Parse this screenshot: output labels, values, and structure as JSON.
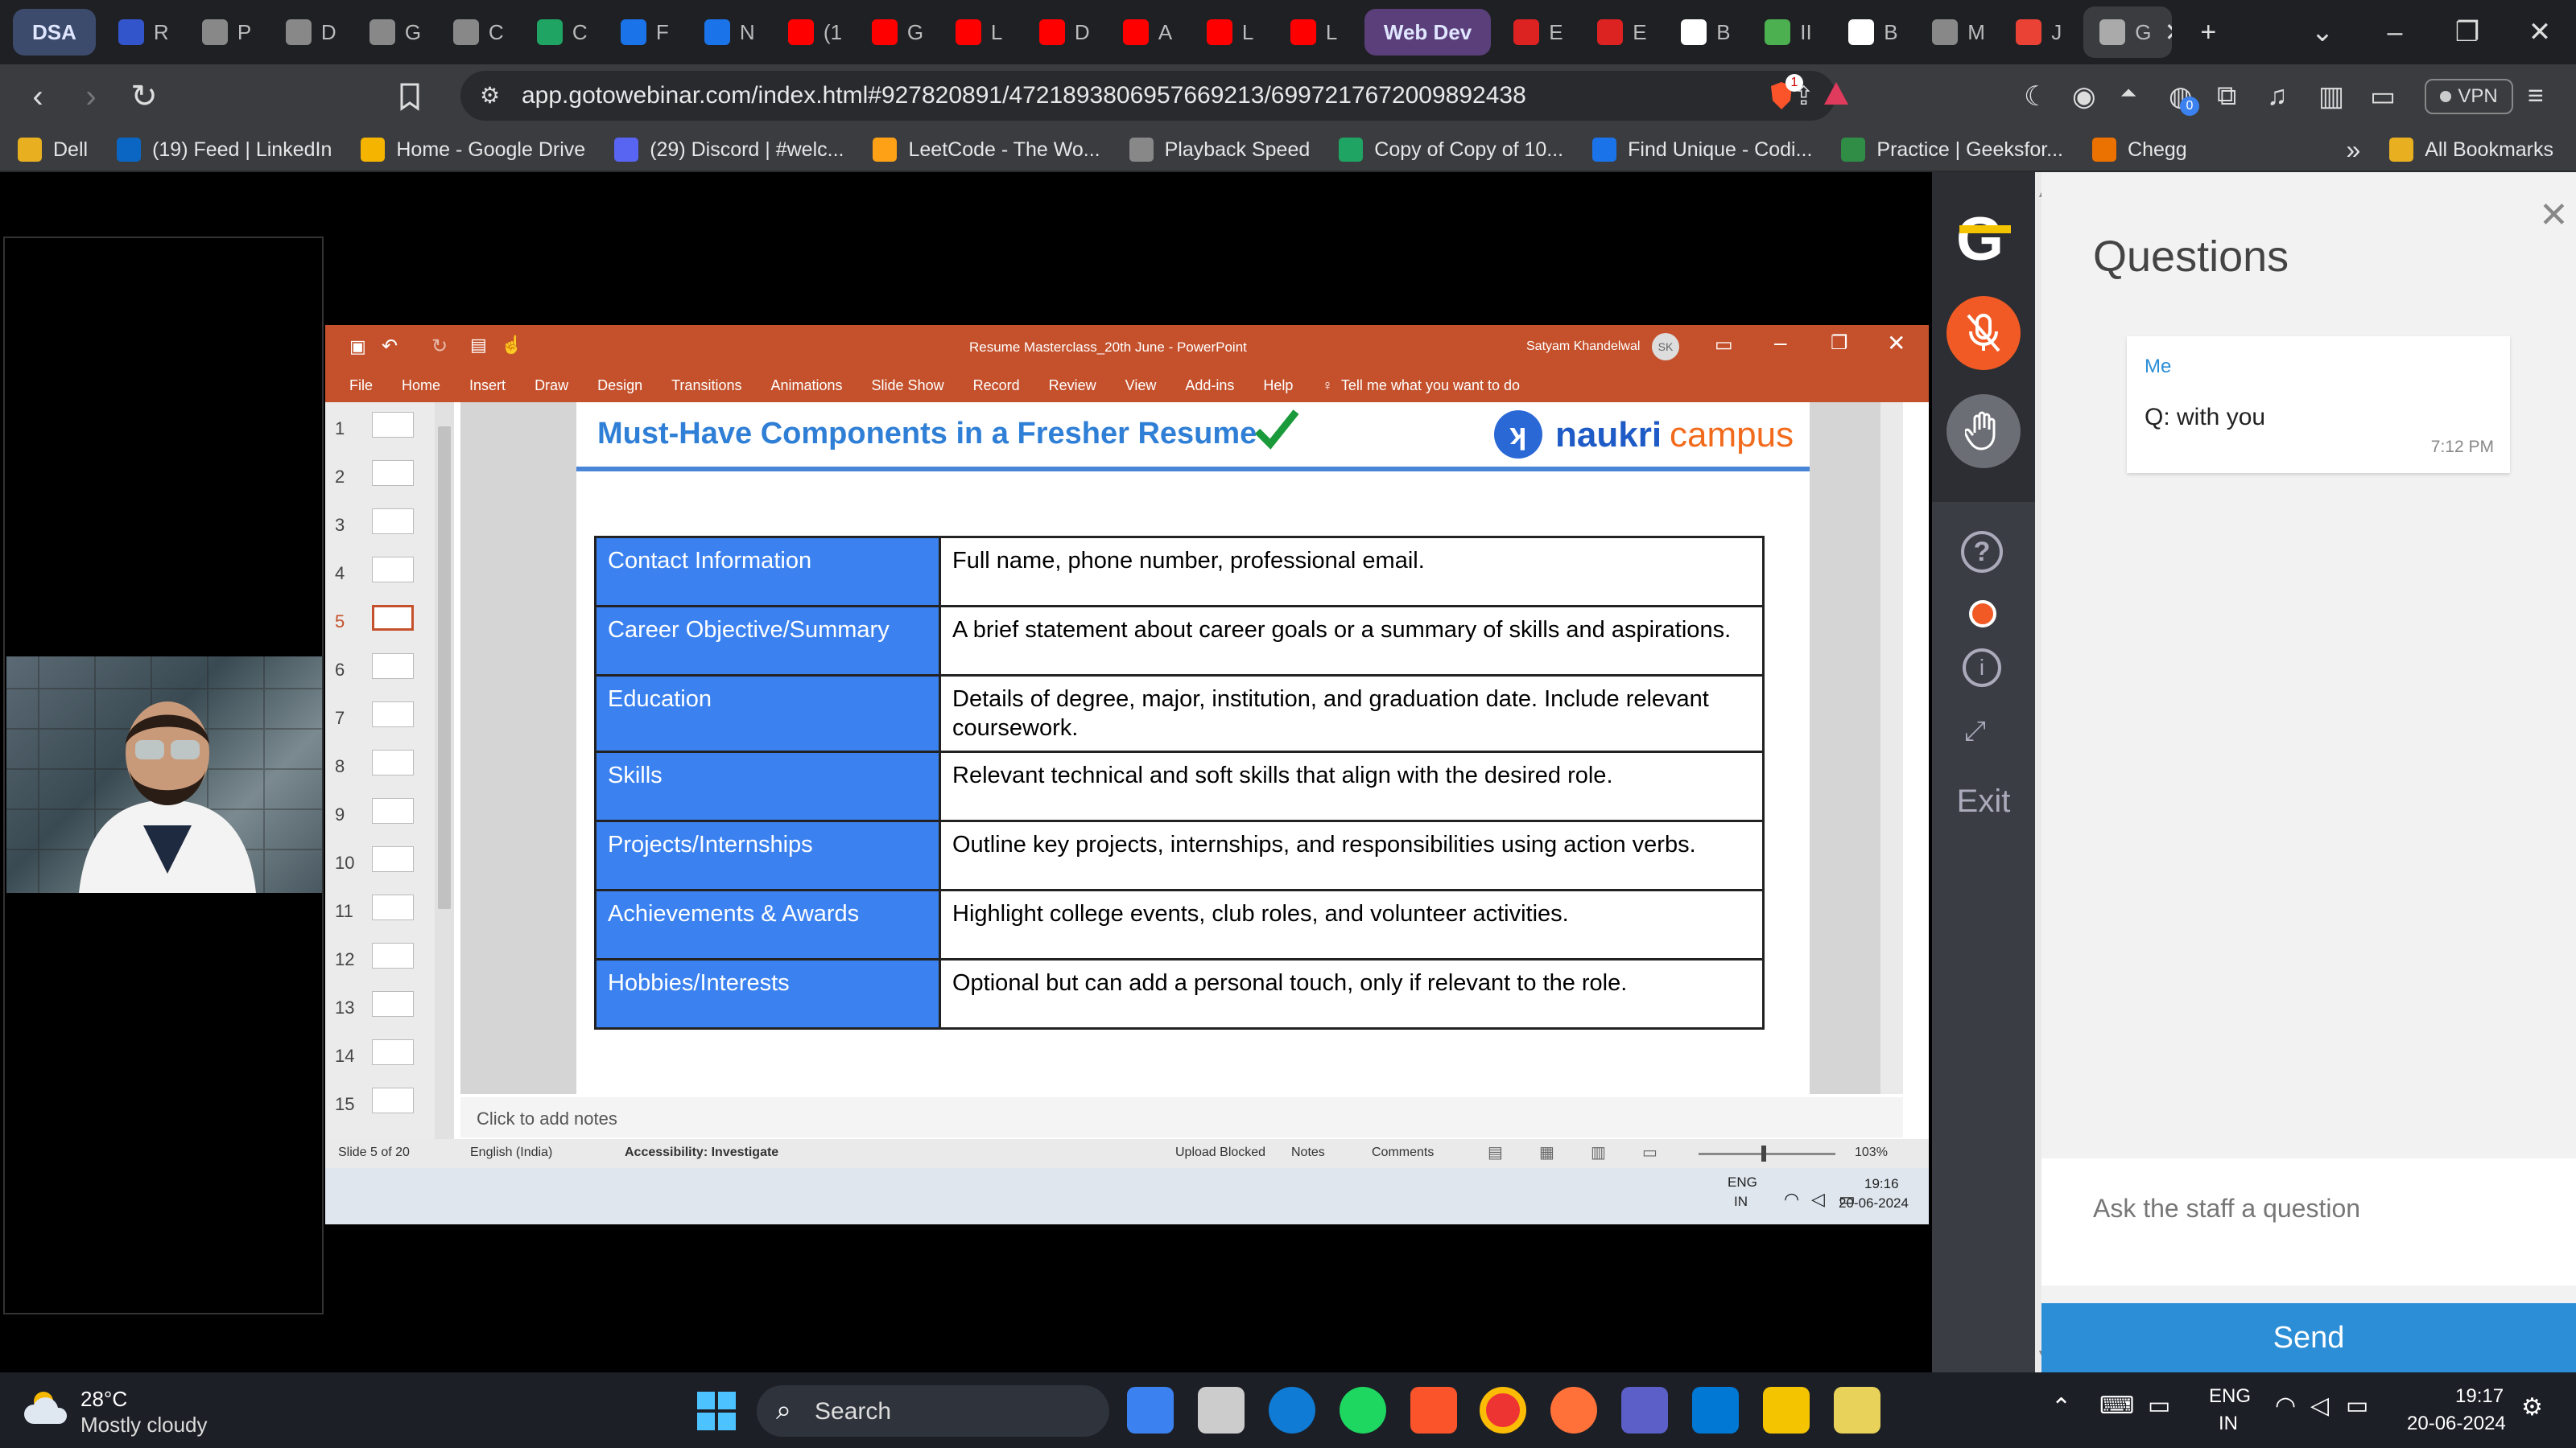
{
  "browser": {
    "tabs": [
      {
        "label": "DSA",
        "kind": "group",
        "color": "#3c4b6b"
      },
      {
        "label": "R",
        "icon": "r-icon",
        "color": "#3355cc"
      },
      {
        "label": "P",
        "icon": "mountain-icon",
        "color": "#888"
      },
      {
        "label": "D",
        "icon": "mountain-icon",
        "color": "#888"
      },
      {
        "label": "G",
        "icon": "mountain-icon",
        "color": "#888"
      },
      {
        "label": "C",
        "icon": "globe-icon",
        "color": "#888"
      },
      {
        "label": "C",
        "icon": "plus-green-icon",
        "color": "#1fa463"
      },
      {
        "label": "F",
        "icon": "codingninja-icon",
        "color": "#1a73e8"
      },
      {
        "label": "N",
        "icon": "codingninja-icon",
        "color": "#1a73e8"
      },
      {
        "label": "(1",
        "icon": "youtube-icon",
        "color": "#ff0000"
      },
      {
        "label": "G",
        "icon": "youtube-icon",
        "color": "#ff0000"
      },
      {
        "label": "L",
        "icon": "youtube-icon",
        "color": "#ff0000"
      },
      {
        "label": "D",
        "icon": "youtube-icon",
        "color": "#ff0000"
      },
      {
        "label": "A",
        "icon": "youtube-icon",
        "color": "#ff0000"
      },
      {
        "label": "L",
        "icon": "youtube-icon",
        "color": "#ff0000"
      },
      {
        "label": "L",
        "icon": "youtube-icon",
        "color": "#ff0000"
      },
      {
        "label": "Web Dev",
        "kind": "group",
        "color": "#5a3f7a"
      },
      {
        "label": "E",
        "icon": "tag-red-icon",
        "color": "#d22"
      },
      {
        "label": "E",
        "icon": "tag-red-icon",
        "color": "#d22"
      },
      {
        "label": "B",
        "icon": "github-icon",
        "color": "#fff"
      },
      {
        "label": "II",
        "icon": "leaf-icon",
        "color": "#4caf50"
      },
      {
        "label": "B",
        "icon": "chatgpt-icon",
        "color": "#fff"
      },
      {
        "label": "M",
        "icon": "globe-icon",
        "color": "#888"
      },
      {
        "label": "J",
        "icon": "gmail-icon",
        "color": "#ea4335"
      },
      {
        "label": "G",
        "icon": "goto-icon",
        "color": "#aaa",
        "active": true
      }
    ],
    "url": "app.gotowebinar.com/index.html#927820891/4721893806957669213/6997217672009892438",
    "vpn_label": "VPN",
    "brave_badge": "1",
    "ext_badge": "0",
    "bookmarks": [
      {
        "label": "Dell",
        "icon": "folder-icon",
        "color": "#e8b020"
      },
      {
        "label": "(19) Feed | LinkedIn",
        "icon": "linkedin-icon",
        "color": "#0a66c2"
      },
      {
        "label": "Home - Google Drive",
        "icon": "drive-icon",
        "color": "#f4b400"
      },
      {
        "label": "(29) Discord | #welc...",
        "icon": "discord-icon",
        "color": "#5865f2"
      },
      {
        "label": "LeetCode - The Wo...",
        "icon": "leetcode-icon",
        "color": "#ffa116"
      },
      {
        "label": "Playback Speed",
        "icon": "globe-icon",
        "color": "#888"
      },
      {
        "label": "Copy of Copy of 10...",
        "icon": "sheets-icon",
        "color": "#1fa463"
      },
      {
        "label": "Find Unique - Codi...",
        "icon": "codingninja-icon",
        "color": "#1a73e8"
      },
      {
        "label": "Practice | Geeksfor...",
        "icon": "gfg-icon",
        "color": "#2f8d46"
      },
      {
        "label": "Chegg",
        "icon": "chegg-icon",
        "color": "#eb7100"
      }
    ],
    "all_bookmarks": "All Bookmarks"
  },
  "ppt": {
    "window_title": "Resume Masterclass_20th June  -  PowerPoint",
    "user": "Satyam Khandelwal",
    "user_initials": "SK",
    "ribbon_tabs": [
      "File",
      "Home",
      "Insert",
      "Draw",
      "Design",
      "Transitions",
      "Animations",
      "Slide Show",
      "Record",
      "Review",
      "View",
      "Add-ins",
      "Help"
    ],
    "tell_me": "Tell me what you want to do",
    "thumbnails": [
      "1",
      "2",
      "3",
      "4",
      "5",
      "6",
      "7",
      "8",
      "9",
      "10",
      "11",
      "12",
      "13",
      "14",
      "15"
    ],
    "active_slide": 5,
    "slide": {
      "title": "Must-Have Components in a Fresher Resume",
      "logo_naukri": "naukri",
      "logo_campus": "campus",
      "rows": [
        {
          "k": "Contact Information",
          "v": "Full name, phone number, professional email."
        },
        {
          "k": "Career Objective/Summary",
          "v": "A brief statement about career goals or a summary of skills and aspirations."
        },
        {
          "k": "Education",
          "v": "Details of degree, major, institution, and graduation date. Include relevant coursework."
        },
        {
          "k": "Skills",
          "v": "Relevant technical and soft skills that align with the desired role."
        },
        {
          "k": "Projects/Internships",
          "v": "Outline key projects, internships, and responsibilities using action verbs."
        },
        {
          "k": "Achievements & Awards",
          "v": "Highlight college events, club roles, and volunteer activities."
        },
        {
          "k": "Hobbies/Interests",
          "v": "Optional but can add a personal touch, only if relevant to the role."
        }
      ]
    },
    "notes_placeholder": "Click to add notes",
    "status": {
      "slide_of": "Slide 5 of 20",
      "language": "English (India)",
      "accessibility": "Accessibility: Investigate",
      "upload": "Upload Blocked",
      "notes": "Notes",
      "comments": "Comments",
      "zoom": "103%"
    },
    "inner_taskbar": {
      "lang": "ENG",
      "region": "IN",
      "time": "19:16",
      "date": "20-06-2024"
    }
  },
  "goto": {
    "logo": "G",
    "exit_label": "Exit",
    "mic_color": "#f15a24"
  },
  "questions": {
    "title": "Questions",
    "message_author": "Me",
    "message_text": "Q: with you",
    "message_time": "7:12 PM",
    "input_placeholder": "Ask the staff a question",
    "send_label": "Send",
    "send_color": "#2b8ed6"
  },
  "taskbar": {
    "weather_temp": "28°C",
    "weather_desc": "Mostly cloudy",
    "search_label": "Search",
    "lang": "ENG",
    "region": "IN",
    "time": "19:17",
    "date": "20-06-2024"
  }
}
